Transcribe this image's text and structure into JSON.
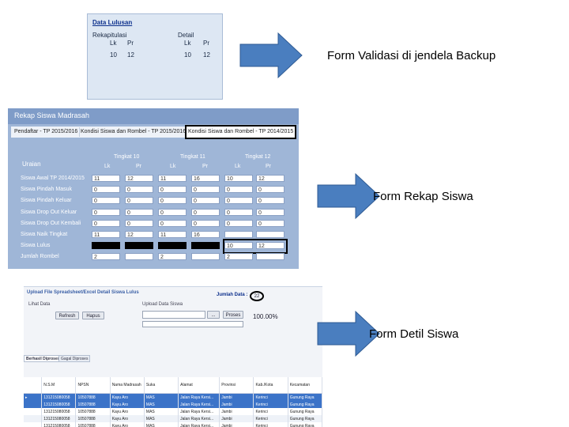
{
  "data_lulusan": {
    "title": "Data Lulusan",
    "rekap_label": "Rekapitulasi",
    "detail_label": "Detail",
    "lk": "Lk",
    "pr": "Pr",
    "rekap_lk": "10",
    "rekap_pr": "12",
    "detail_lk": "10",
    "detail_pr": "12"
  },
  "captions": {
    "backup": "Form Validasi di jendela Backup",
    "rekap": "Form Rekap Siswa",
    "detil": "Form Detil Siswa"
  },
  "rekap_siswa": {
    "title": "Rekap Siswa Madrasah",
    "tabs": [
      "Pendaftar - TP 2015/2016",
      "Kondisi Siswa dan Rombel - TP 2015/2016",
      "Kondisi Siswa dan Rombel - TP 2014/2015"
    ],
    "uraian": "Uraian",
    "levels": [
      "Tingkat 10",
      "Tingkat 11",
      "Tingkat 12"
    ],
    "lk": "Lk",
    "pr": "Pr",
    "rows": [
      {
        "label": "Siswa Awal TP 2014/2015",
        "values": [
          "11",
          "12",
          "11",
          "16",
          "10",
          "12"
        ]
      },
      {
        "label": "Siswa Pindah Masuk",
        "values": [
          "0",
          "0",
          "0",
          "0",
          "0",
          "0"
        ]
      },
      {
        "label": "Siswa Pindah Keluar",
        "values": [
          "0",
          "0",
          "0",
          "0",
          "0",
          "0"
        ]
      },
      {
        "label": "Siswa Drop Out Keluar",
        "values": [
          "0",
          "0",
          "0",
          "0",
          "0",
          "0"
        ]
      },
      {
        "label": "Siswa Drop Out Kembali",
        "values": [
          "0",
          "0",
          "0",
          "0",
          "0",
          "0"
        ]
      },
      {
        "label": "Siswa Naik Tingkat",
        "values": [
          "11",
          "12",
          "11",
          "16",
          "",
          ""
        ]
      },
      {
        "label": "Siswa Lulus",
        "values": [
          "",
          "",
          "",
          "",
          "10",
          "12"
        ]
      },
      {
        "label": "Jumlah Rombel",
        "values": [
          "2",
          "",
          "2",
          "",
          "2",
          ""
        ]
      }
    ]
  },
  "upload_detail": {
    "title": "Upload File Spreadsheet/Excel Detail Siswa Lulus",
    "jumlah_label": "Jumlah Data :",
    "jumlah_value": "22",
    "lihat_data": "Lihat Data",
    "upload_label": "Upload Data Siswa",
    "refresh": "Refresh",
    "hapus": "Hapus",
    "browse": "...",
    "proses": "Proses",
    "percent": "100.00%",
    "tabs": [
      "Berhasil Diproses",
      "Gagal Diproses"
    ],
    "columns": [
      "N.S.M",
      "NPSN",
      "Nama Madrasah",
      "Suka",
      "Alamat",
      "Provinsi",
      "Kab./Kota",
      "Kecamatan"
    ],
    "rows": [
      {
        "marker": "▸",
        "cells": [
          "131215080058",
          "10507888",
          "Kayu Aro",
          "MAS",
          "Jalan Raya Kersi...",
          "Jambi",
          "Kerinci",
          "Gunung Raya"
        ]
      },
      {
        "marker": "",
        "cells": [
          "131215080058",
          "10507888",
          "Kayu Aro",
          "MAS",
          "Jalan Raya Kersi...",
          "Jambi",
          "Kerinci",
          "Gunung Raya"
        ]
      },
      {
        "marker": "",
        "cells": [
          "131215080058",
          "10507888",
          "Kayu Aro",
          "MAS",
          "Jalan Raya Kersi...",
          "Jambi",
          "Kerinci",
          "Gunung Raya"
        ]
      },
      {
        "marker": "",
        "cells": [
          "131215080058",
          "10507888",
          "Kayu Aro",
          "MAS",
          "Jalan Raya Kersi...",
          "Jambi",
          "Kerinci",
          "Gunung Raya"
        ]
      },
      {
        "marker": "",
        "cells": [
          "131215080058",
          "10507888",
          "Kayu Aro",
          "MAS",
          "Jalan Raya Kersi...",
          "Jambi",
          "Kerinci",
          "Gunung Raya"
        ]
      }
    ]
  },
  "colors": {
    "arrow_fill": "#4a7ebf",
    "arrow_stroke": "#2e5a93",
    "panel_blue": "#9fb6d7",
    "selected_row": "#3b73c8"
  }
}
